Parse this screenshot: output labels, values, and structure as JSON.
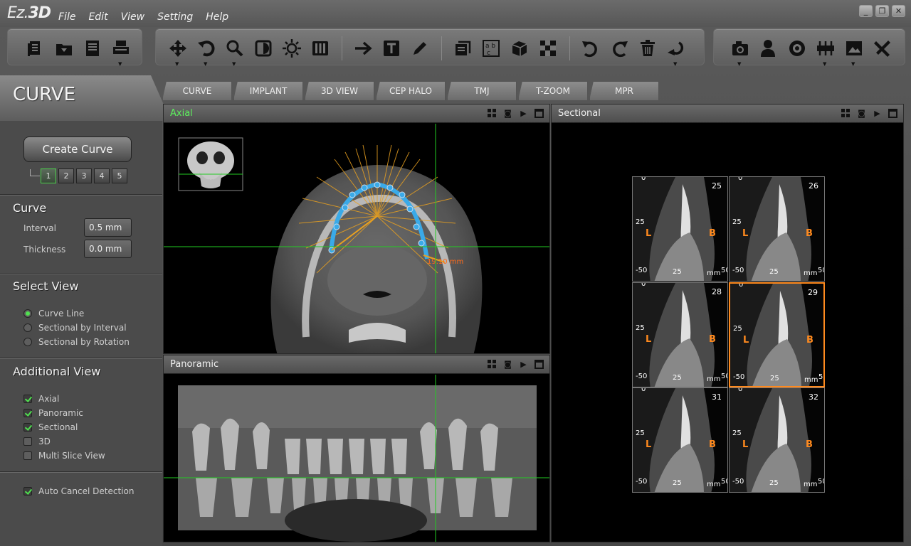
{
  "app": {
    "logo_left": "Ez.",
    "logo_right": "3D",
    "menu": [
      "File",
      "Edit",
      "View",
      "Setting",
      "Help"
    ],
    "window_controls": [
      "_",
      "❐",
      "✕"
    ]
  },
  "toolbar": {
    "groups": [
      [
        "document-icon",
        "folder-open-icon",
        "save-icon",
        "print-icon"
      ],
      [
        "move-icon",
        "undo-rotate-icon",
        "zoom-icon",
        "contrast-icon",
        "brightness-icon",
        "filter-icon",
        "arrow-icon",
        "text-icon",
        "pencil-icon",
        "layers-icon",
        "abc-icon",
        "cube-icon",
        "checker-icon",
        "undo-icon",
        "redo-icon",
        "trash-icon",
        "reset-icon"
      ],
      [
        "camera-icon",
        "person-icon",
        "disc-icon",
        "ruler-icon",
        "image-icon",
        "tools-icon"
      ]
    ]
  },
  "mode": {
    "title": "CURVE"
  },
  "tabs": [
    "CURVE",
    "IMPLANT",
    "3D VIEW",
    "CEP HALO",
    "TMJ",
    "T-ZOOM",
    "MPR"
  ],
  "left": {
    "create_label": "Create Curve",
    "curve_numbers": [
      "1",
      "2",
      "3",
      "4",
      "5"
    ],
    "curve": {
      "header": "Curve",
      "interval_label": "Interval",
      "interval_value": "0.5 mm",
      "thickness_label": "Thickness",
      "thickness_value": "0.0 mm"
    },
    "select_view": {
      "header": "Select View",
      "options": [
        {
          "label": "Curve Line",
          "checked": true
        },
        {
          "label": "Sectional by Interval",
          "checked": false
        },
        {
          "label": "Sectional by Rotation",
          "checked": false
        }
      ]
    },
    "additional_view": {
      "header": "Additional View",
      "options": [
        {
          "label": "Axial",
          "checked": true
        },
        {
          "label": "Panoramic",
          "checked": true
        },
        {
          "label": "Sectional",
          "checked": true
        },
        {
          "label": "3D",
          "checked": false
        },
        {
          "label": "Multi Slice View",
          "checked": false
        }
      ]
    },
    "auto_cancel": {
      "label": "Auto Cancel Detection",
      "checked": true
    }
  },
  "axial": {
    "title": "Axial",
    "measure": "19.10 mm",
    "colors": {
      "crosshair": "#22cc22",
      "curve": "#3aaae8",
      "lines": "#e8a020"
    }
  },
  "panoramic": {
    "title": "Panoramic"
  },
  "sectional": {
    "title": "Sectional",
    "cells": [
      {
        "num": "25",
        "selected": false
      },
      {
        "num": "26",
        "selected": false
      },
      {
        "num": "28",
        "selected": false
      },
      {
        "num": "29",
        "selected": true
      },
      {
        "num": "31",
        "selected": false
      },
      {
        "num": "32",
        "selected": false
      }
    ],
    "tick_labels": {
      "top": "0",
      "mid": "25",
      "bottom": "-50",
      "x25": "25",
      "unit": "mm",
      "x50": "50"
    },
    "left_label": "L",
    "right_label": "B",
    "accent": "#ff8a1e"
  }
}
